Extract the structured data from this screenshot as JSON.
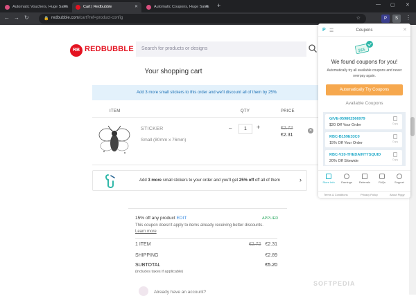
{
  "browser": {
    "tabs": [
      {
        "label": "Automatic Vouchers, Huge Sales"
      },
      {
        "label": "Cart | Redbubble"
      },
      {
        "label": "Automatic Coupons, Huge Sales"
      }
    ],
    "new_tab": "+",
    "url_host": "redbubble.com",
    "url_path": "/cart?ref=product-config"
  },
  "site": {
    "logo_text": "REDBUBBLE",
    "logo_mark": "RB",
    "search_placeholder": "Search for products or designs"
  },
  "cart": {
    "title": "Your shopping cart",
    "banner": "Add 3 more small stickers to this order and we'll discount all of them by 25%",
    "columns": {
      "item": "ITEM",
      "qty": "QTY",
      "price": "PRICE"
    },
    "item": {
      "name": "STICKER",
      "size": "Small (80mm x 76mm)",
      "quantity": "1",
      "price_old": "€2.72",
      "price_new": "€2.31",
      "minus": "–",
      "plus": "+"
    },
    "promo": {
      "prefix": "Add ",
      "bold1": "3 more",
      "mid": " small stickers to your order and you'll get ",
      "bold2": "25% off",
      "suffix": " off all of them",
      "arrow": "›"
    }
  },
  "summary": {
    "coupon_title": "15% off any product",
    "coupon_edit": "EDIT",
    "coupon_status": "APPLIED",
    "coupon_note": "This coupon doesn't apply to items already receiving better discounts.",
    "learn_more": "Learn more",
    "rows": [
      {
        "label": "1 ITEM",
        "old": "€2.72",
        "value": "€2.31"
      },
      {
        "label": "SHIPPING",
        "old": "",
        "value": "€2.89"
      },
      {
        "label": "SUBTOTAL",
        "old": "",
        "value": "€5.20"
      }
    ],
    "taxes_note": "(includes taxes if applicable)",
    "account_hint": "Already have an account?"
  },
  "piggy": {
    "title": "Coupons",
    "found": "We found coupons for you!",
    "desc_line1": "Automatically try all available coupons and never",
    "desc_line2": "overpay again.",
    "button": "Automatically Try Coupons",
    "available": "Available Coupons",
    "coupons": [
      {
        "code": "GIVE-959802566979",
        "deal": "$20 Off Your Order",
        "copy": "Copy"
      },
      {
        "code": "RBC-B159E33C0",
        "deal": "15% Off Your Order",
        "copy": "Copy"
      },
      {
        "code": "RBC-V20-THEDAINTYSQUID",
        "deal": "20% Off Sitewide",
        "copy": "Copy"
      }
    ],
    "nav": [
      {
        "label": "Store Info"
      },
      {
        "label": "Earnings"
      },
      {
        "label": "Referrals"
      },
      {
        "label": "FAQs"
      },
      {
        "label": "Support"
      }
    ],
    "footer": [
      "Terms & Conditions",
      "Privacy Policy",
      "About Piggy"
    ]
  },
  "watermark": "SOFTPEDIA",
  "colors": {
    "brand": "#e41321",
    "piggy_teal": "#20b5c8",
    "piggy_orange": "#f6a84e",
    "applied_green": "#2ba860"
  }
}
